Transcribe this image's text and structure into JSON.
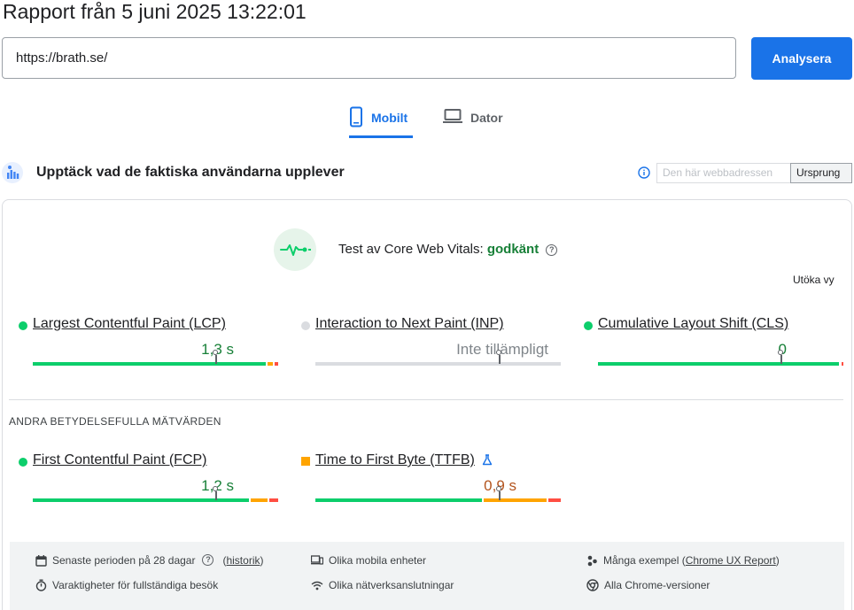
{
  "report": {
    "title": "Rapport från 5 juni 2025 13:22:01"
  },
  "search": {
    "value": "https://brath.se/",
    "button_label": "Analysera"
  },
  "tabs": [
    {
      "label": "Mobilt",
      "icon": "smartphone-icon",
      "active": true
    },
    {
      "label": "Dator",
      "icon": "laptop-icon",
      "active": false
    }
  ],
  "crux": {
    "heading": "Upptäck vad de faktiska användarna upplever",
    "toggle": {
      "url_label": "Den här webbadressen",
      "origin_label": "Ursprung",
      "selected": "Ursprung"
    }
  },
  "cwv": {
    "title_prefix": "Test av Core Web Vitals:",
    "status": "godkänt",
    "expand_label": "Utöka vy"
  },
  "metrics": [
    {
      "name": "Largest Contentful Paint (LCP)",
      "value": "1,3 s",
      "rating": "good"
    },
    {
      "name": "Interaction to Next Paint (INP)",
      "value": "Inte tillämpligt",
      "rating": "na"
    },
    {
      "name": "Cumulative Layout Shift (CLS)",
      "value": "0",
      "rating": "good"
    }
  ],
  "other_metrics": {
    "label": "ANDRA BETYDELSEFULLA MÄTVÄRDEN",
    "items": [
      {
        "name": "First Contentful Paint (FCP)",
        "value": "1,2 s",
        "rating": "good"
      },
      {
        "name": "Time to First Byte (TTFB)",
        "value": "0,9 s",
        "rating": "needs-improvement",
        "experimental_icon": "flask-icon"
      }
    ]
  },
  "footer": {
    "period": "Senaste perioden på 28 dagar",
    "history_link": "historik",
    "durations": "Varaktigheter för fullständiga besök",
    "devices": "Olika mobila enheter",
    "networks": "Olika nätverksanslutningar",
    "samples_prefix": "Många exempel (",
    "samples_link": "Chrome UX Report",
    "samples_suffix": ")",
    "versions": "Alla Chrome-versioner"
  },
  "colors": {
    "accent": "#1a73e8",
    "good": "#0cce6b",
    "good_text": "#188038",
    "needs_improvement": "#ffa400",
    "needs_improvement_text": "#b3541e",
    "poor": "#ff4e42",
    "na": "#dadce0"
  }
}
